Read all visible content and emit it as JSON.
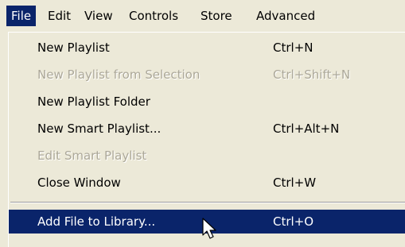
{
  "menubar": {
    "items": [
      {
        "label": "File",
        "active": true
      },
      {
        "label": "Edit"
      },
      {
        "label": "View"
      },
      {
        "label": "Controls"
      },
      {
        "label": "Store"
      },
      {
        "label": "Advanced"
      }
    ]
  },
  "file_menu": {
    "items": [
      {
        "label": "New Playlist",
        "shortcut": "Ctrl+N",
        "enabled": true
      },
      {
        "label": "New Playlist from Selection",
        "shortcut": "Ctrl+Shift+N",
        "enabled": false
      },
      {
        "label": "New Playlist Folder",
        "shortcut": "",
        "enabled": true
      },
      {
        "label": "New Smart Playlist...",
        "shortcut": "Ctrl+Alt+N",
        "enabled": true
      },
      {
        "label": "Edit Smart Playlist",
        "shortcut": "",
        "enabled": false
      },
      {
        "label": "Close Window",
        "shortcut": "Ctrl+W",
        "enabled": true
      },
      {
        "label": "Add File to Library...",
        "shortcut": "Ctrl+O",
        "enabled": true,
        "highlighted": true
      }
    ]
  },
  "colors": {
    "menu_background": "#ece9d8",
    "highlight": "#0a246a",
    "highlight_text": "#ffffff",
    "disabled_text": "#aca899"
  },
  "pointer": {
    "icon": "arrow-cursor-icon"
  }
}
